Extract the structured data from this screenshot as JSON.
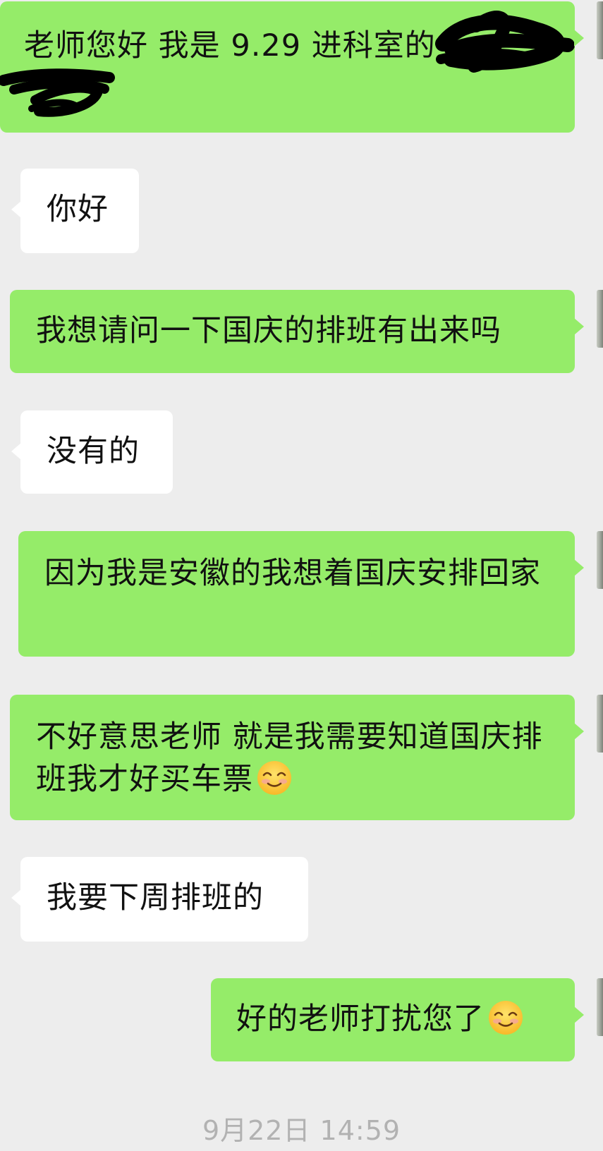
{
  "messages": [
    {
      "side": "sent",
      "text": "老师您好 我是 9.29 进科室的"
    },
    {
      "side": "received",
      "text": "你好"
    },
    {
      "side": "sent",
      "text": "我想请问一下国庆的排班有出来吗"
    },
    {
      "side": "received",
      "text": "没有的"
    },
    {
      "side": "sent",
      "text": "因为我是安徽的我想着国庆安排回家"
    },
    {
      "side": "sent",
      "text": "不好意思老师 就是我需要知道国庆排班我才好买车票",
      "emoji": "smiling-face-icon"
    },
    {
      "side": "received",
      "text": "我要下周排班的"
    },
    {
      "side": "sent",
      "text": "好的老师打扰您了",
      "emoji": "smiling-face-icon"
    }
  ],
  "timestamp": "9月22日 14:59",
  "colors": {
    "sent_bubble": "#95ec69",
    "received_bubble": "#ffffff",
    "background": "#ededed",
    "timestamp_text": "#b2b2b2"
  }
}
